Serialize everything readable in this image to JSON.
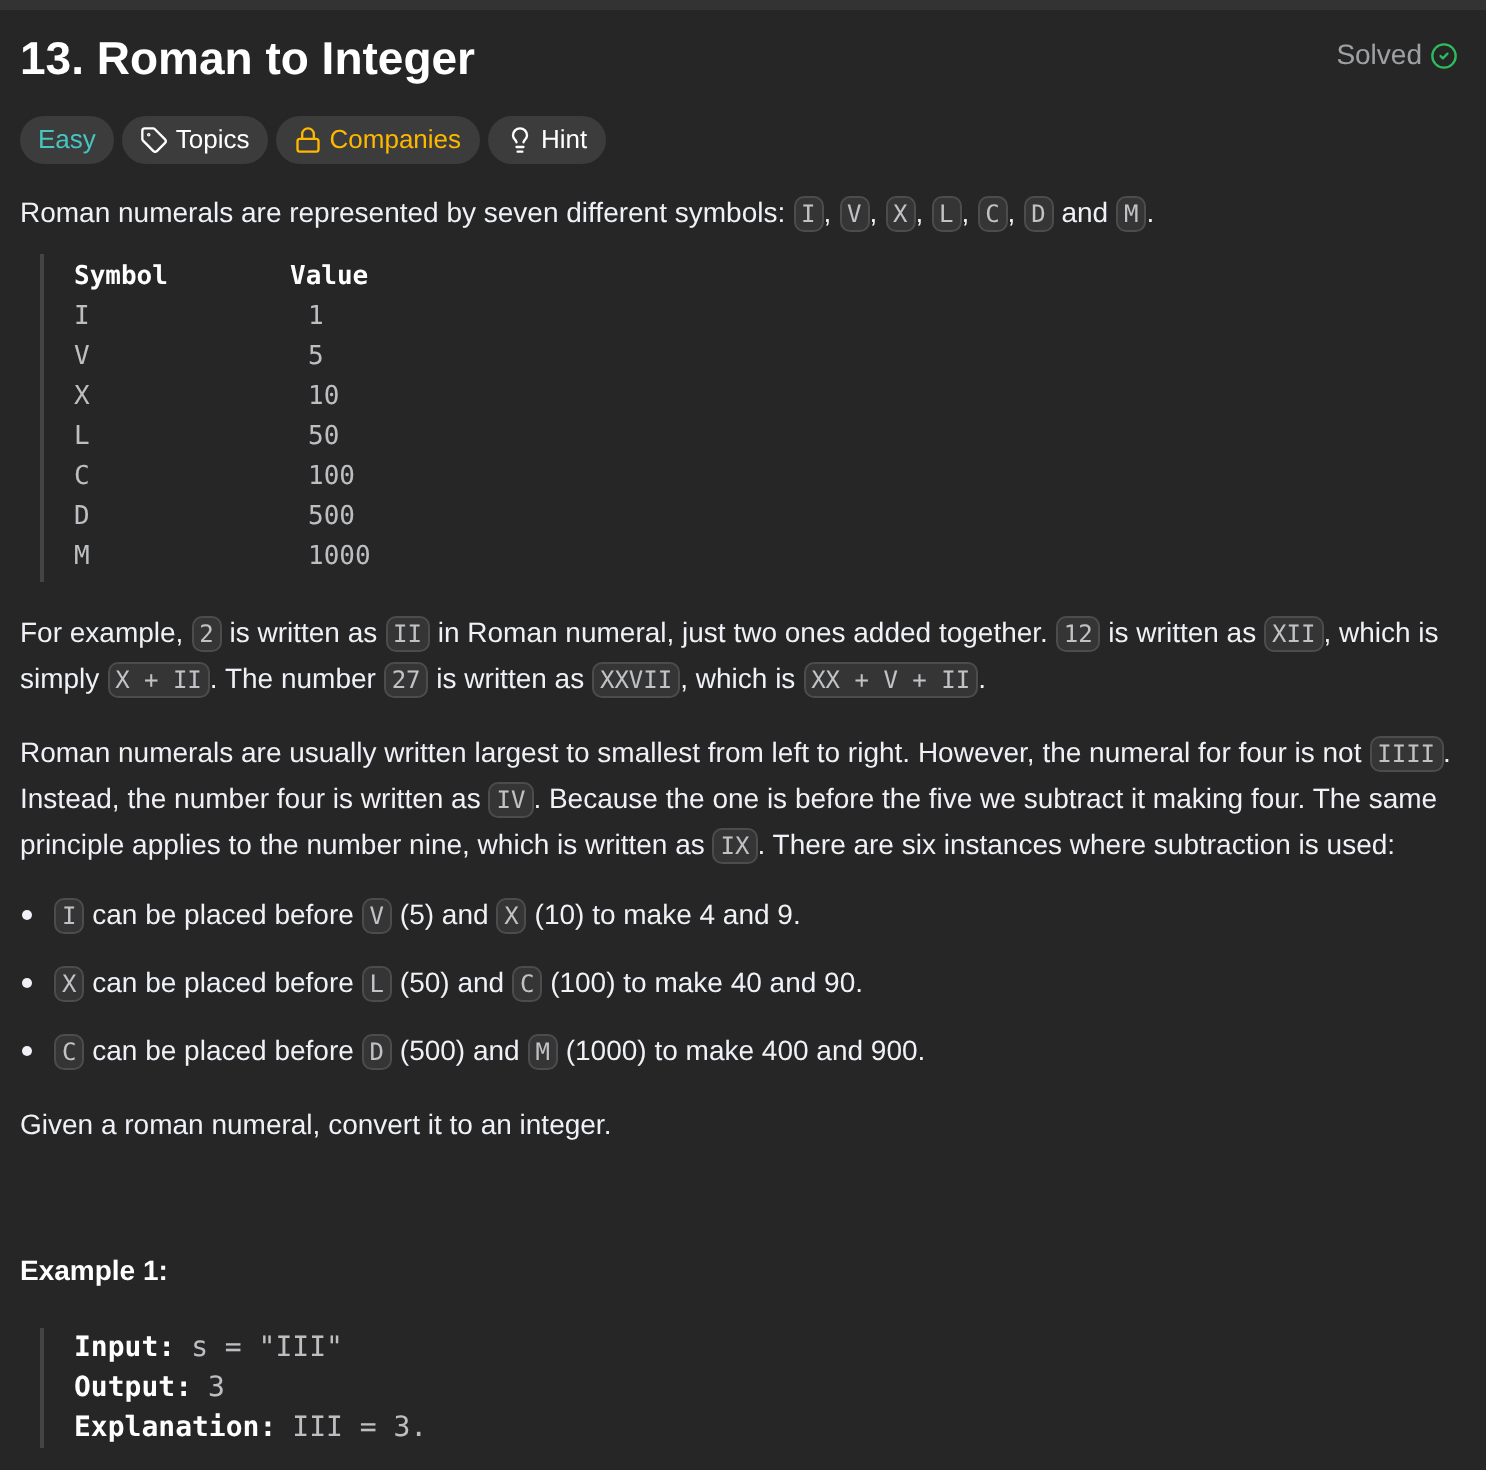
{
  "title": "13. Roman to Integer",
  "status": "Solved",
  "tags": [
    {
      "label": "Easy",
      "kind": "difficulty"
    },
    {
      "label": "Topics",
      "kind": "topics"
    },
    {
      "label": "Companies",
      "kind": "companies"
    },
    {
      "label": "Hint",
      "kind": "hint"
    }
  ],
  "intro": [
    {
      "t": "Roman numerals are represented by seven different symbols: ",
      "code": false
    },
    {
      "t": "I",
      "code": true
    },
    {
      "t": ", ",
      "code": false
    },
    {
      "t": "V",
      "code": true
    },
    {
      "t": ", ",
      "code": false
    },
    {
      "t": "X",
      "code": true
    },
    {
      "t": ", ",
      "code": false
    },
    {
      "t": "L",
      "code": true
    },
    {
      "t": ", ",
      "code": false
    },
    {
      "t": "C",
      "code": true
    },
    {
      "t": ", ",
      "code": false
    },
    {
      "t": "D",
      "code": true
    },
    {
      "t": " and ",
      "code": false
    },
    {
      "t": "M",
      "code": true
    },
    {
      "t": ".",
      "code": false
    }
  ],
  "symbol_table": {
    "columns": [
      "Symbol",
      "Value"
    ],
    "rows": [
      [
        "I",
        "1"
      ],
      [
        "V",
        "5"
      ],
      [
        "X",
        "10"
      ],
      [
        "L",
        "50"
      ],
      [
        "C",
        "100"
      ],
      [
        "D",
        "500"
      ],
      [
        "M",
        "1000"
      ]
    ]
  },
  "paragraphs": [
    [
      {
        "t": "For example, ",
        "code": false
      },
      {
        "t": "2",
        "code": true
      },
      {
        "t": " is written as ",
        "code": false
      },
      {
        "t": "II",
        "code": true
      },
      {
        "t": " in Roman numeral, just two ones added together. ",
        "code": false
      },
      {
        "t": "12",
        "code": true
      },
      {
        "t": " is written as ",
        "code": false
      },
      {
        "t": "XII",
        "code": true
      },
      {
        "t": ", which is simply ",
        "code": false
      },
      {
        "t": "X + II",
        "code": true
      },
      {
        "t": ". The number ",
        "code": false
      },
      {
        "t": "27",
        "code": true
      },
      {
        "t": " is written as ",
        "code": false
      },
      {
        "t": "XXVII",
        "code": true
      },
      {
        "t": ", which is ",
        "code": false
      },
      {
        "t": "XX + V + II",
        "code": true
      },
      {
        "t": ".",
        "code": false
      }
    ],
    [
      {
        "t": "Roman numerals are usually written largest to smallest from left to right. However, the numeral for four is not ",
        "code": false
      },
      {
        "t": "IIII",
        "code": true
      },
      {
        "t": ". Instead, the number four is written as ",
        "code": false
      },
      {
        "t": "IV",
        "code": true
      },
      {
        "t": ". Because the one is before the five we subtract it making four. The same principle applies to the number nine, which is written as ",
        "code": false
      },
      {
        "t": "IX",
        "code": true
      },
      {
        "t": ". There are six instances where subtraction is used:",
        "code": false
      }
    ]
  ],
  "bullets": [
    [
      {
        "t": "I",
        "code": true
      },
      {
        "t": " can be placed before ",
        "code": false
      },
      {
        "t": "V",
        "code": true
      },
      {
        "t": " (5) and ",
        "code": false
      },
      {
        "t": "X",
        "code": true
      },
      {
        "t": " (10) to make 4 and 9.",
        "code": false
      }
    ],
    [
      {
        "t": "X",
        "code": true
      },
      {
        "t": " can be placed before ",
        "code": false
      },
      {
        "t": "L",
        "code": true
      },
      {
        "t": " (50) and ",
        "code": false
      },
      {
        "t": "C",
        "code": true
      },
      {
        "t": " (100) to make 40 and 90.",
        "code": false
      }
    ],
    [
      {
        "t": "C",
        "code": true
      },
      {
        "t": " can be placed before ",
        "code": false
      },
      {
        "t": "D",
        "code": true
      },
      {
        "t": " (500) and ",
        "code": false
      },
      {
        "t": "M",
        "code": true
      },
      {
        "t": " (1000) to make 400 and 900.",
        "code": false
      }
    ]
  ],
  "closing": "Given a roman numeral, convert it to an integer.",
  "example": {
    "title": "Example 1:",
    "lines": [
      {
        "label": "Input:",
        "value": "s = \"III\""
      },
      {
        "label": "Output:",
        "value": "3"
      },
      {
        "label": "Explanation:",
        "value": "III = 3."
      }
    ]
  }
}
